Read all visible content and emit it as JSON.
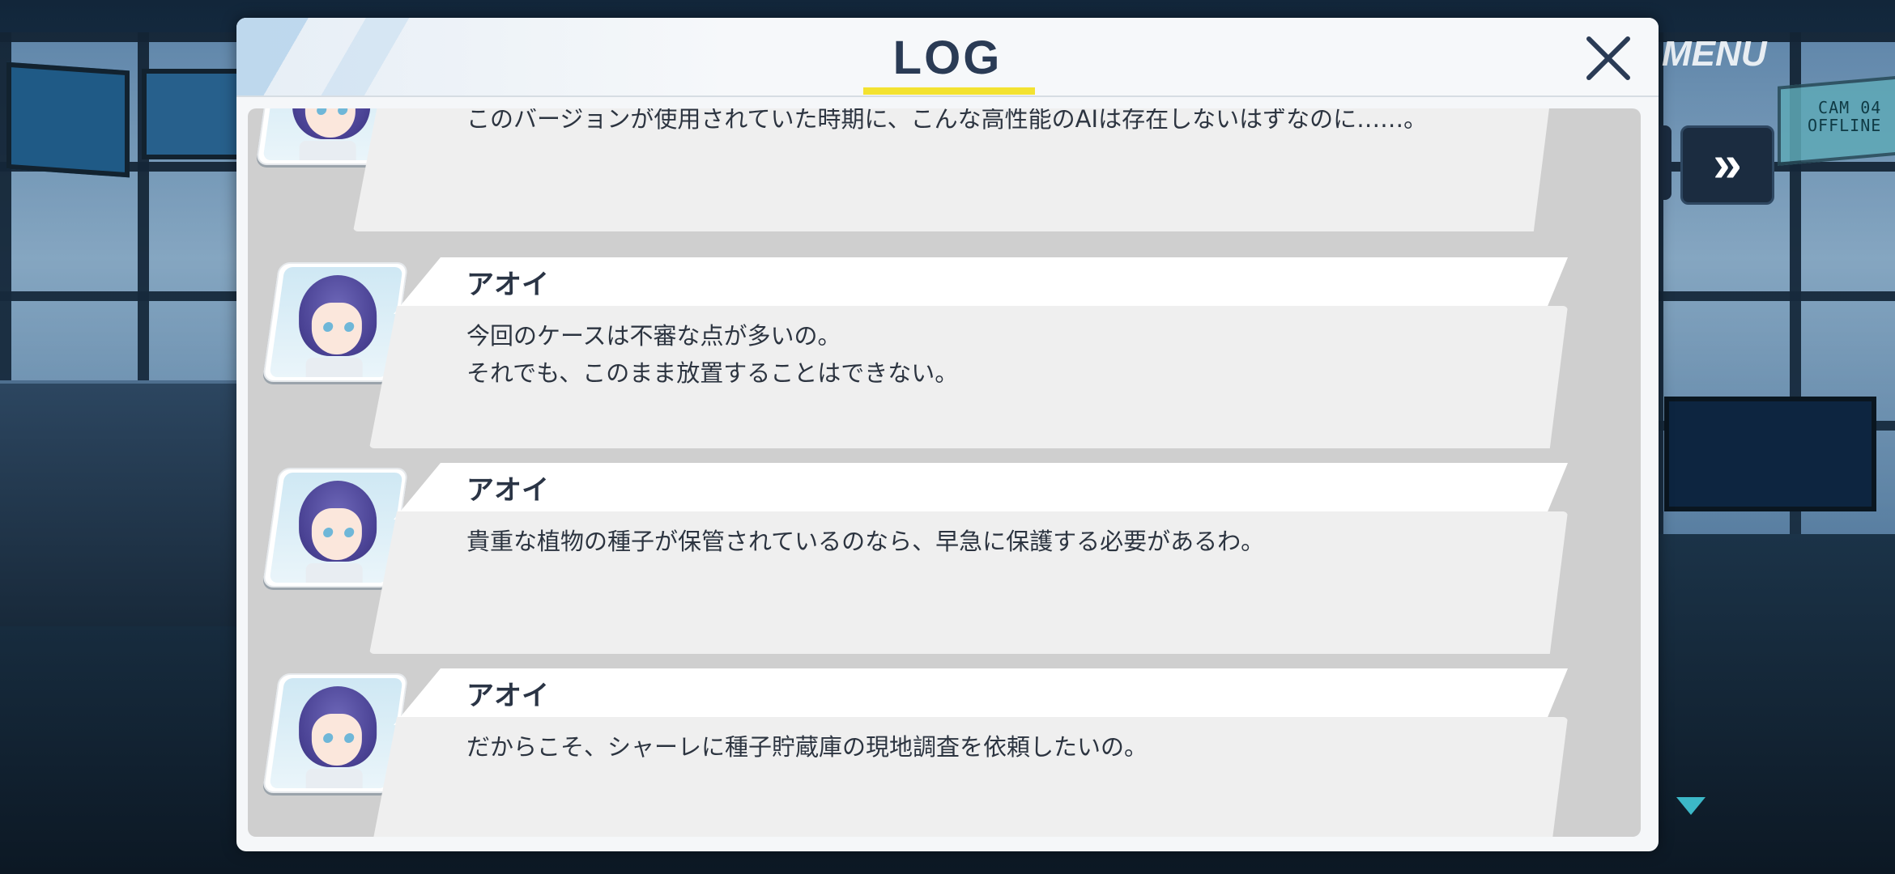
{
  "hud": {
    "menu_label": "MENU",
    "fast_forward_label": "»",
    "camera_text_line1": "CAM 04",
    "camera_text_line2": "OFFLINE"
  },
  "log": {
    "title": "LOG",
    "close_icon": "close-icon",
    "accent_color": "#f3e230",
    "entries": [
      {
        "speaker": "",
        "text": "このバージョンが使用されていた時期に、こんな高性能のAIは存在しないはずなのに……。"
      },
      {
        "speaker": "アオイ",
        "text": "今回のケースは不審な点が多いの。\nそれでも、このまま放置することはできない。"
      },
      {
        "speaker": "アオイ",
        "text": "貴重な植物の種子が保管されているのなら、早急に保護する必要があるわ。"
      },
      {
        "speaker": "アオイ",
        "text": "だからこそ、シャーレに種子貯蔵庫の現地調査を依頼したいの。"
      }
    ]
  }
}
